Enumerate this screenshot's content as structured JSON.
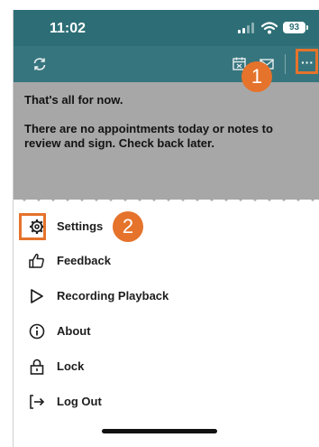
{
  "status_bar": {
    "time": "11:02",
    "battery": "93",
    "icons": [
      "signal-icon",
      "wifi-icon",
      "battery-icon"
    ]
  },
  "toolbar": {
    "icons": [
      "refresh-icon",
      "calendar-icon",
      "mail-icon",
      "more-icon"
    ]
  },
  "content": {
    "title": "That's all for now.",
    "message": "There are no appointments today or notes to review and sign. Check back later."
  },
  "annotations": {
    "step1": "1",
    "step2": "2",
    "highlight_color": "#e5732b"
  },
  "menu": {
    "items": [
      {
        "label": "Settings",
        "icon": "gear-icon"
      },
      {
        "label": "Feedback",
        "icon": "thumbs-up-icon"
      },
      {
        "label": "Recording Playback",
        "icon": "play-icon"
      },
      {
        "label": "About",
        "icon": "info-icon"
      },
      {
        "label": "Lock",
        "icon": "lock-icon"
      },
      {
        "label": "Log Out",
        "icon": "logout-icon"
      }
    ]
  },
  "colors": {
    "header": "#2d6e76",
    "toolbar": "#36757e",
    "overlay": "#a7a7a7"
  }
}
